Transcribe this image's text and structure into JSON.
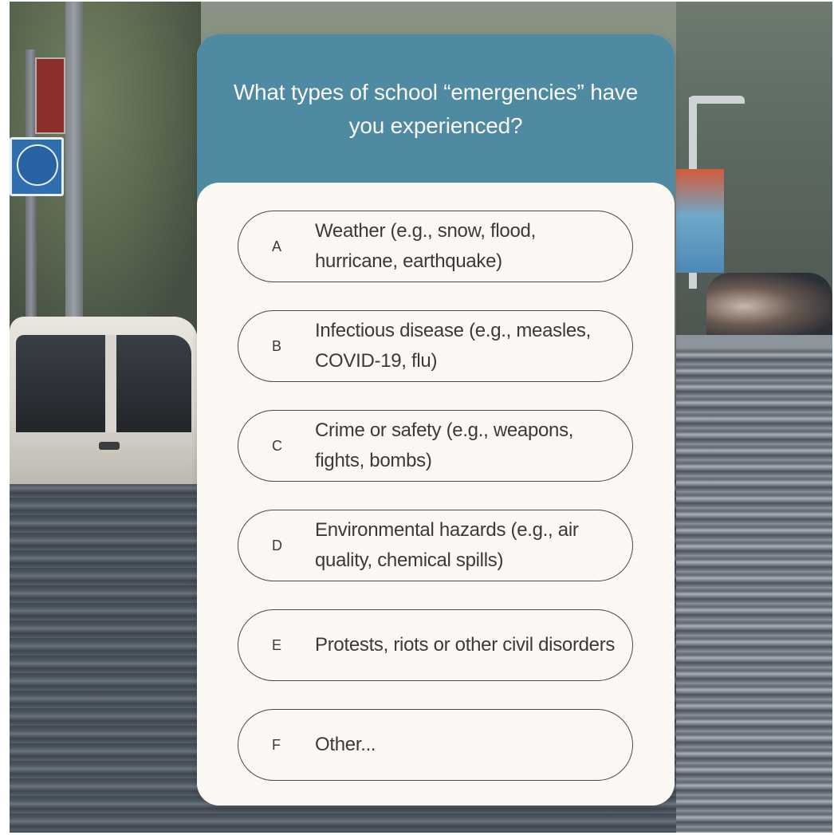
{
  "question": {
    "title": "What types of school “emergencies” have you experienced?"
  },
  "options": [
    {
      "letter": "A",
      "label": "Weather (e.g., snow, flood, hurricane, earthquake)"
    },
    {
      "letter": "B",
      "label": "Infectious disease (e.g., measles, COVID-19, flu)"
    },
    {
      "letter": "C",
      "label": "Crime or safety (e.g., weapons, fights, bombs)"
    },
    {
      "letter": "D",
      "label": "Environmental hazards (e.g., air quality, chemical spills)"
    },
    {
      "letter": "E",
      "label": "Protests, riots or other civil disorders"
    },
    {
      "letter": "F",
      "label": "Other..."
    }
  ],
  "colors": {
    "header": "#4e8aa1",
    "card": "#fbf8f4",
    "text": "#3a3a3a"
  },
  "background": {
    "description_icon": "flooded-street-photo"
  }
}
